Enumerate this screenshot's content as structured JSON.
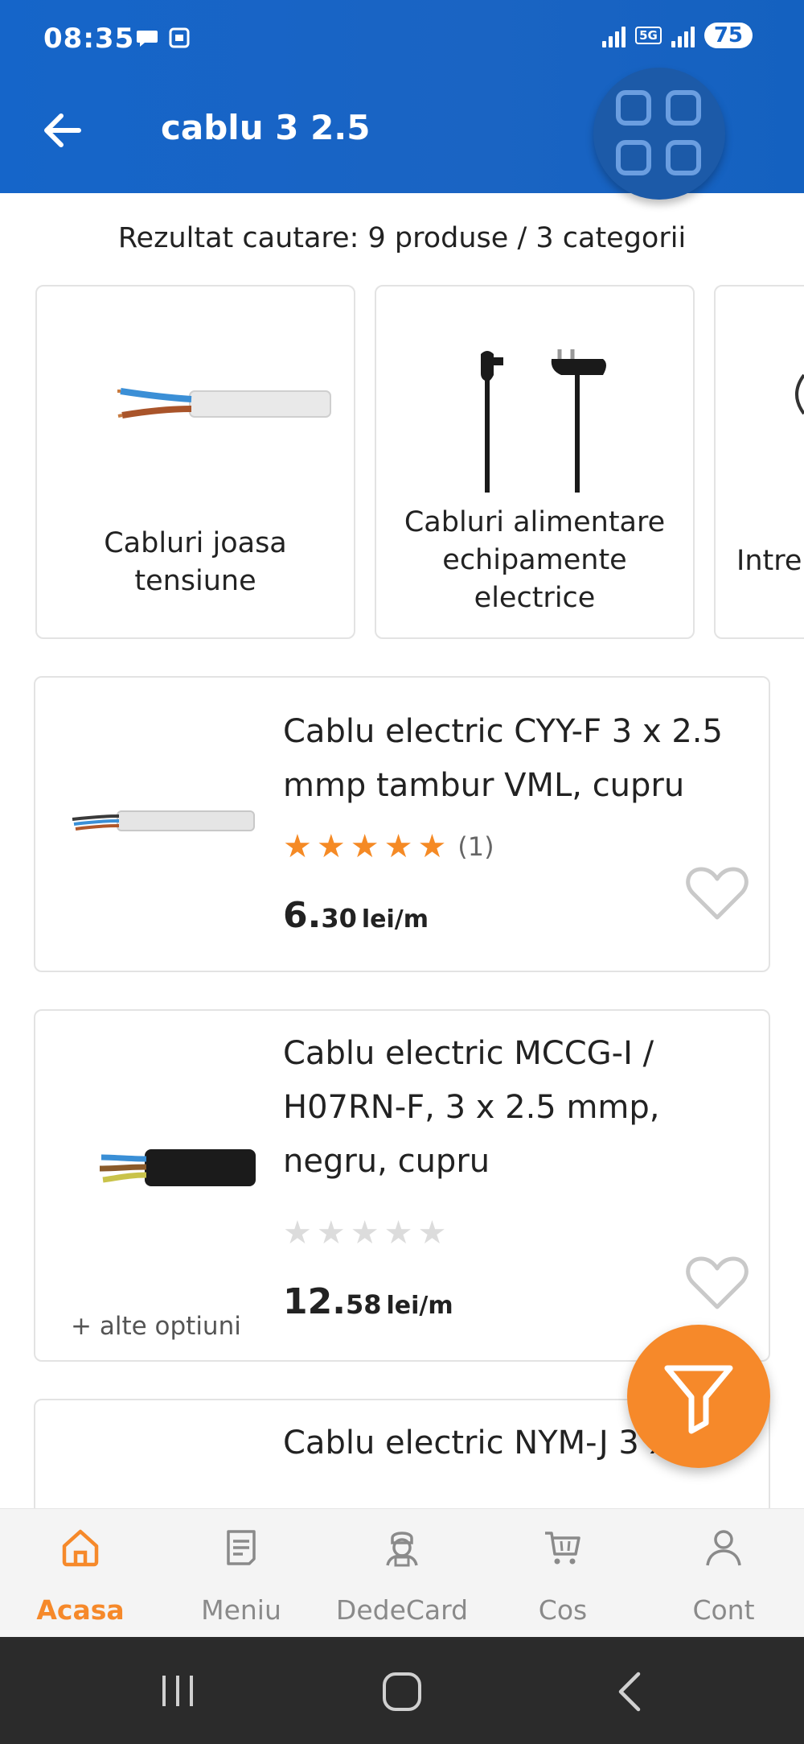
{
  "status_bar": {
    "time": "08:35",
    "network": "5G",
    "battery": "75"
  },
  "header": {
    "search_query": "cablu 3 2.5",
    "back_icon": "arrow-left-icon",
    "menu_icon": "grid-icon"
  },
  "results": {
    "summary": "Rezultat cautare: 9 produse / 3 categorii"
  },
  "categories": [
    {
      "label_line1": "Cabluri joasa",
      "label_line2": "tensiune",
      "label_line3": ""
    },
    {
      "label_line1": "Cabluri alimentare",
      "label_line2": "echipamente",
      "label_line3": "electrice"
    },
    {
      "label_line1": "Intre",
      "label_line2": "",
      "label_line3": ""
    }
  ],
  "products": [
    {
      "title_line1": "Cablu electric CYY-F 3 x 2.5",
      "title_line2": "mmp tambur VML, cupru",
      "title_line3": "",
      "rating": 5,
      "rating_count": "(1)",
      "price_int": "6.",
      "price_dec": "30",
      "unit": "lei/m",
      "more_options": ""
    },
    {
      "title_line1": "Cablu electric MCCG-I /",
      "title_line2": "H07RN-F, 3 x 2.5 mmp,",
      "title_line3": "negru, cupru",
      "rating": 0,
      "rating_count": "",
      "price_int": "12.",
      "price_dec": "58",
      "unit": "lei/m",
      "more_options": "+ alte optiuni"
    },
    {
      "title_line1": "Cablu electric NYM-J 3 x 2.5",
      "title_line2": "",
      "title_line3": ""
    }
  ],
  "fab": {
    "icon": "filter-icon"
  },
  "bottom_nav": {
    "items": [
      {
        "label": "Acasa",
        "icon": "home-icon",
        "active": true
      },
      {
        "label": "Meniu",
        "icon": "menu-list-icon",
        "active": false
      },
      {
        "label": "DedeCard",
        "icon": "dedecard-icon",
        "active": false
      },
      {
        "label": "Cos",
        "icon": "cart-icon",
        "active": false
      },
      {
        "label": "Cont",
        "icon": "user-icon",
        "active": false
      }
    ]
  },
  "colors": {
    "header_blue": "#1565c9",
    "accent_orange": "#f6892a",
    "star_orange": "#f58a25"
  }
}
